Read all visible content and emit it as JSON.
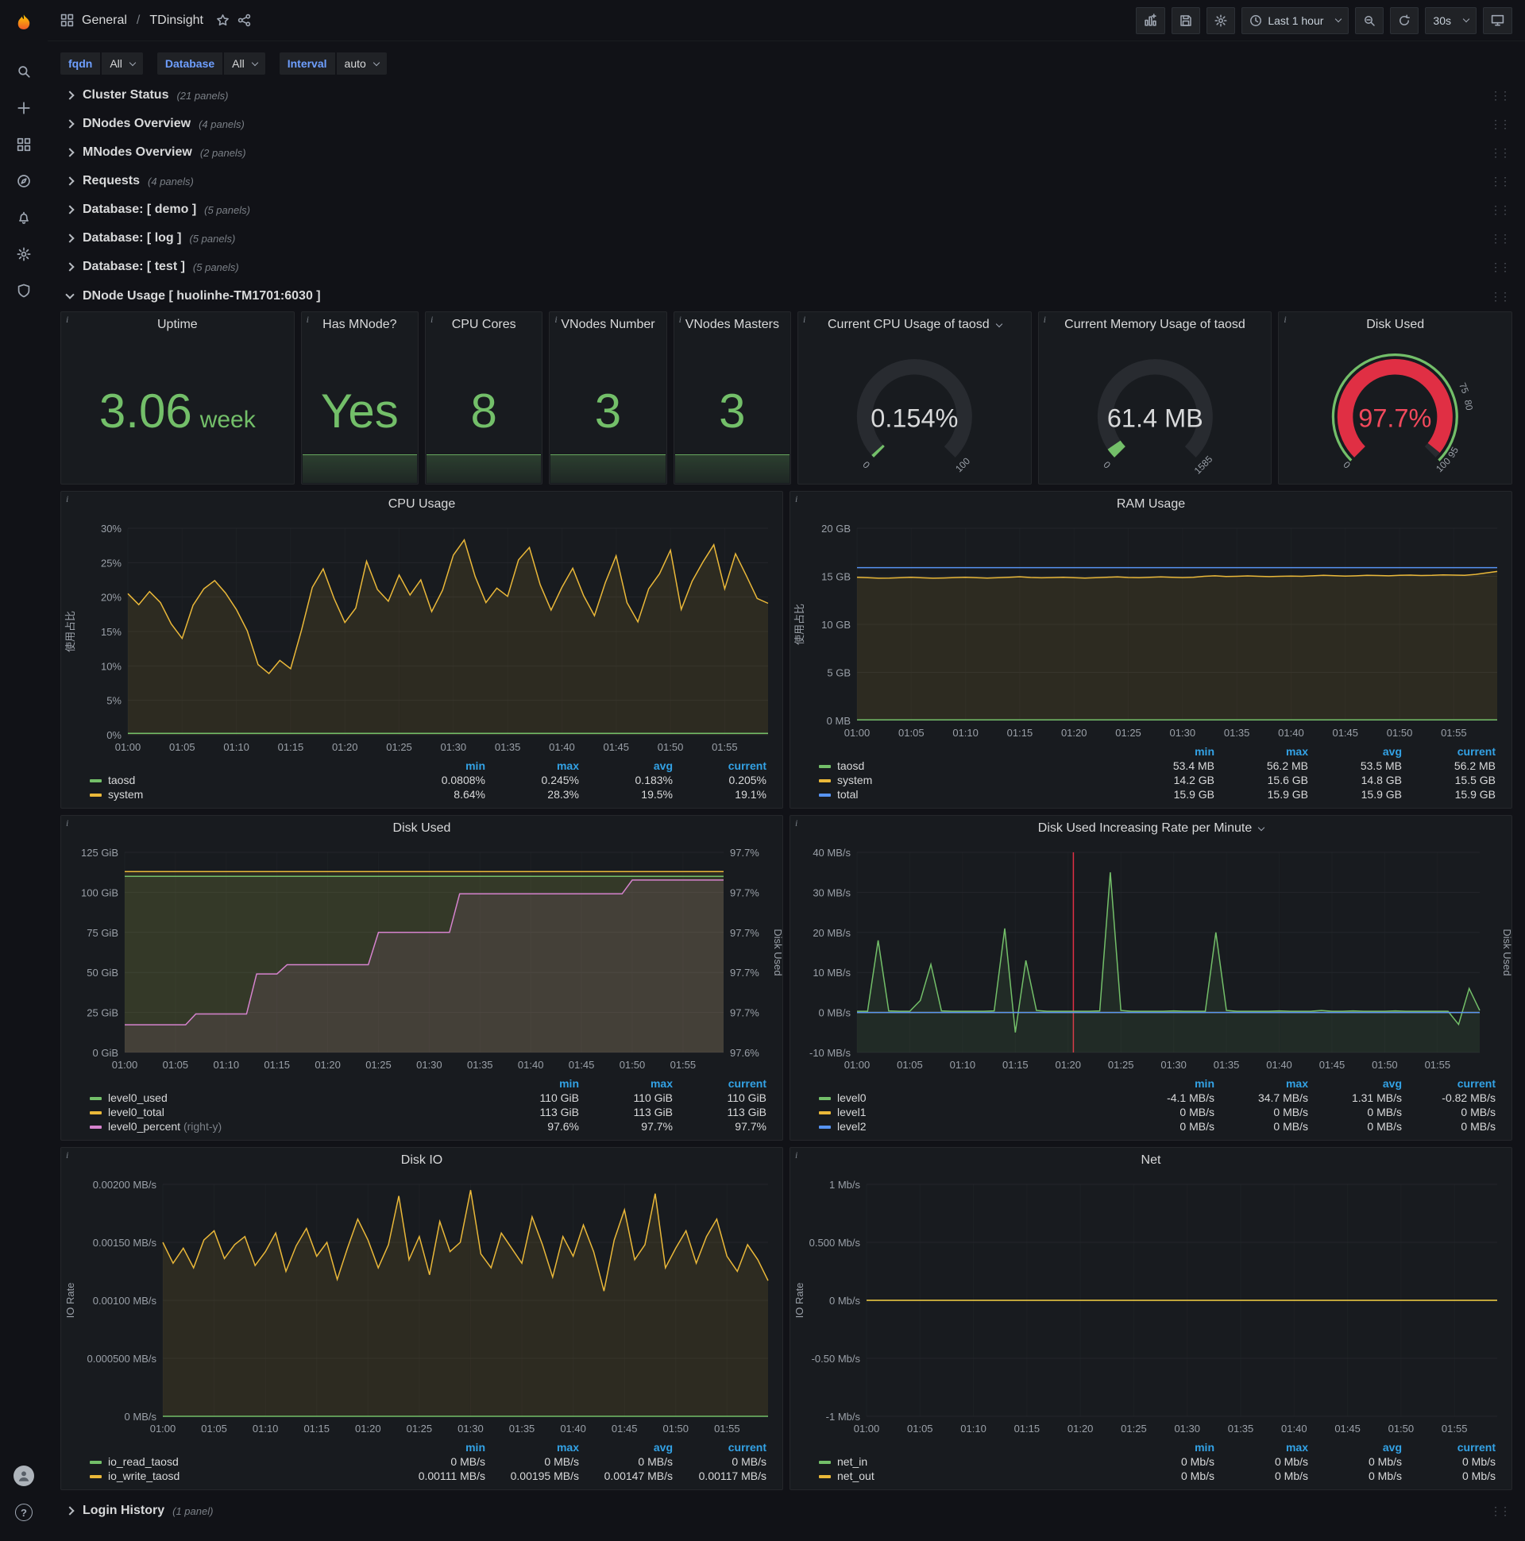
{
  "topbar": {
    "breadcrumb_folder": "General",
    "breadcrumb_separator": "/",
    "dashboard_title": "TDinsight",
    "time_range_label": "Last 1 hour",
    "refresh_label": "30s"
  },
  "variables": [
    {
      "label": "fqdn",
      "value": "All"
    },
    {
      "label": "Database",
      "value": "All"
    },
    {
      "label": "Interval",
      "value": "auto"
    }
  ],
  "collapsed_rows": [
    {
      "title": "Cluster Status",
      "count": "(21 panels)"
    },
    {
      "title": "DNodes Overview",
      "count": "(4 panels)"
    },
    {
      "title": "MNodes Overview",
      "count": "(2 panels)"
    },
    {
      "title": "Requests",
      "count": "(4 panels)"
    },
    {
      "title": "Database: [ demo ]",
      "count": "(5 panels)"
    },
    {
      "title": "Database: [ log ]",
      "count": "(5 panels)"
    },
    {
      "title": "Database: [ test ]",
      "count": "(5 panels)"
    }
  ],
  "dnode_row": {
    "title": "DNode Usage [ huolinhe-TM1701:6030 ]"
  },
  "login_row": {
    "title": "Login History",
    "count": "(1 panel)"
  },
  "stat_panels": [
    {
      "title": "Uptime",
      "value": "3.06",
      "unit": "week"
    },
    {
      "title": "Has MNode?",
      "value": "Yes"
    },
    {
      "title": "CPU Cores",
      "value": "8"
    },
    {
      "title": "VNodes Number",
      "value": "3"
    },
    {
      "title": "VNodes Masters",
      "value": "3"
    }
  ],
  "gauge_panels": [
    {
      "id": "cpu_gauge",
      "title": "Current CPU Usage of taosd",
      "value": "0.154%",
      "percent": 0.154,
      "arc_color": "#73bf69",
      "value_color": "#d8d9da",
      "min_label": "0",
      "max_label": "100",
      "dropdown": true
    },
    {
      "id": "mem_gauge",
      "title": "Current Memory Usage of taosd",
      "value": "61.4 MB",
      "percent": 3.9,
      "arc_color": "#73bf69",
      "value_color": "#d8d9da",
      "min_label": "0",
      "max_label": "1585"
    },
    {
      "id": "disk_gauge",
      "title": "Disk Used",
      "value": "97.7%",
      "percent": 97.7,
      "arc_color": "#e02f44",
      "value_color": "#f2495c",
      "min_label": "0",
      "outer_ring": true,
      "ticks": [
        {
          "f": 0.75,
          "l": "75"
        },
        {
          "f": 0.8,
          "l": "80"
        },
        {
          "f": 0.95,
          "l": "95"
        },
        {
          "f": 1,
          "l": "100"
        }
      ]
    }
  ],
  "chart_data": [
    {
      "id": "cpu_usage",
      "type": "line",
      "title": "CPU Usage",
      "ylabel": "使用占比",
      "ylim": [
        0,
        30
      ],
      "n": 60,
      "ml": 84,
      "mr": 18,
      "yticks": [
        {
          "v": 0,
          "l": "0%"
        },
        {
          "v": 5,
          "l": "5%"
        },
        {
          "v": 10,
          "l": "10%"
        },
        {
          "v": 15,
          "l": "15%"
        },
        {
          "v": 20,
          "l": "20%"
        },
        {
          "v": 25,
          "l": "25%"
        },
        {
          "v": 30,
          "l": "30%"
        }
      ],
      "xticks": [
        "01:00",
        "01:05",
        "01:10",
        "01:15",
        "01:20",
        "01:25",
        "01:30",
        "01:35",
        "01:40",
        "01:45",
        "01:50",
        "01:55"
      ],
      "series": [
        {
          "name": "system",
          "color": "#eab839",
          "fill": true,
          "values": [
            20.5,
            18.9,
            20.8,
            19.2,
            16.1,
            14.0,
            18.8,
            21.2,
            22.4,
            20.6,
            18.2,
            15.1,
            10.2,
            8.9,
            10.8,
            9.6,
            15.2,
            21.4,
            24.1,
            19.8,
            16.3,
            18.4,
            25.2,
            21.1,
            19.4,
            23.2,
            20.3,
            22.5,
            17.9,
            21.0,
            26.1,
            28.3,
            23.0,
            19.2,
            21.3,
            20.1,
            25.4,
            27.2,
            21.8,
            18.1,
            21.4,
            24.2,
            20.2,
            17.3,
            22.1,
            26.0,
            19.2,
            16.4,
            21.2,
            23.4,
            26.8,
            18.2,
            22.3,
            25.1,
            27.6,
            21.2,
            26.3,
            23.1,
            19.8,
            19.1
          ]
        },
        {
          "name": "taosd",
          "color": "#73bf69",
          "flat": 0.2
        }
      ],
      "legend": {
        "columns": [
          "min",
          "max",
          "avg",
          "current"
        ],
        "rows": [
          {
            "name": "taosd",
            "color": "#73bf69",
            "values": [
              "0.0808%",
              "0.245%",
              "0.183%",
              "0.205%"
            ]
          },
          {
            "name": "system",
            "color": "#eab839",
            "values": [
              "8.64%",
              "28.3%",
              "19.5%",
              "19.1%"
            ]
          }
        ]
      }
    },
    {
      "id": "ram_usage",
      "type": "line",
      "title": "RAM Usage",
      "ylabel": "使用占比",
      "ylim": [
        0,
        20
      ],
      "n": 60,
      "ml": 84,
      "mr": 18,
      "yticks": [
        {
          "v": 0,
          "l": "0 MB"
        },
        {
          "v": 5,
          "l": "5 GB"
        },
        {
          "v": 10,
          "l": "10 GB"
        },
        {
          "v": 15,
          "l": "15 GB"
        },
        {
          "v": 20,
          "l": "20 GB"
        }
      ],
      "xticks": [
        "01:00",
        "01:05",
        "01:10",
        "01:15",
        "01:20",
        "01:25",
        "01:30",
        "01:35",
        "01:40",
        "01:45",
        "01:50",
        "01:55"
      ],
      "series": [
        {
          "name": "system",
          "color": "#eab839",
          "fill": true,
          "values": [
            14.9,
            14.85,
            14.8,
            14.82,
            14.86,
            14.9,
            14.84,
            14.8,
            14.83,
            14.87,
            14.9,
            14.86,
            14.82,
            14.85,
            14.9,
            14.95,
            14.88,
            14.84,
            14.87,
            14.9,
            14.85,
            14.82,
            14.86,
            14.9,
            14.93,
            14.88,
            14.85,
            14.9,
            14.94,
            14.9,
            14.87,
            14.9,
            15.0,
            15.05,
            14.98,
            15.0,
            15.04,
            15.0,
            14.97,
            15.0,
            15.02,
            15.0,
            15.05,
            15.1,
            15.06,
            15.02,
            15.05,
            15.1,
            15.08,
            15.05,
            15.1,
            15.12,
            15.08,
            15.1,
            15.15,
            15.12,
            15.1,
            15.2,
            15.35,
            15.5
          ]
        },
        {
          "name": "total",
          "color": "#5794f2",
          "flat": 15.9
        },
        {
          "name": "taosd",
          "color": "#73bf69",
          "flat": 0.055
        }
      ],
      "legend": {
        "columns": [
          "min",
          "max",
          "avg",
          "current"
        ],
        "rows": [
          {
            "name": "taosd",
            "color": "#73bf69",
            "values": [
              "53.4 MB",
              "56.2 MB",
              "53.5 MB",
              "56.2 MB"
            ]
          },
          {
            "name": "system",
            "color": "#eab839",
            "values": [
              "14.2 GB",
              "15.6 GB",
              "14.8 GB",
              "15.5 GB"
            ]
          },
          {
            "name": "total",
            "color": "#5794f2",
            "values": [
              "15.9 GB",
              "15.9 GB",
              "15.9 GB",
              "15.9 GB"
            ]
          }
        ]
      }
    },
    {
      "id": "disk_used",
      "type": "line",
      "title": "Disk Used",
      "ylim": [
        0,
        125
      ],
      "n": 60,
      "ml": 80,
      "mr": 74,
      "y2lim": [
        97.585,
        97.715
      ],
      "y2label": "Disk Used",
      "y2ticks": [
        "97.6%",
        "97.7%",
        "97.7%",
        "97.7%",
        "97.7%",
        "97.7%"
      ],
      "yticks": [
        {
          "v": 0,
          "l": "0 GiB"
        },
        {
          "v": 25,
          "l": "25 GiB"
        },
        {
          "v": 50,
          "l": "50 GiB"
        },
        {
          "v": 75,
          "l": "75 GiB"
        },
        {
          "v": 100,
          "l": "100 GiB"
        },
        {
          "v": 125,
          "l": "125 GiB"
        }
      ],
      "xticks": [
        "01:00",
        "01:05",
        "01:10",
        "01:15",
        "01:20",
        "01:25",
        "01:30",
        "01:35",
        "01:40",
        "01:45",
        "01:50",
        "01:55"
      ],
      "series": [
        {
          "name": "level0_total",
          "color": "#eab839",
          "fill": true,
          "flat": 113
        },
        {
          "name": "level0_used",
          "color": "#73bf69",
          "fill": true,
          "flat": 110
        },
        {
          "name": "level0_percent",
          "color": "#d683ce",
          "fill": true,
          "axis": "y2",
          "values": [
            97.603,
            97.603,
            97.603,
            97.603,
            97.603,
            97.603,
            97.603,
            97.61,
            97.61,
            97.61,
            97.61,
            97.61,
            97.61,
            97.636,
            97.636,
            97.636,
            97.642,
            97.642,
            97.642,
            97.642,
            97.642,
            97.642,
            97.642,
            97.642,
            97.642,
            97.663,
            97.663,
            97.663,
            97.663,
            97.663,
            97.663,
            97.663,
            97.663,
            97.688,
            97.688,
            97.688,
            97.688,
            97.688,
            97.688,
            97.688,
            97.688,
            97.688,
            97.688,
            97.688,
            97.688,
            97.688,
            97.688,
            97.688,
            97.688,
            97.688,
            97.697,
            97.697,
            97.697,
            97.697,
            97.697,
            97.697,
            97.697,
            97.697,
            97.697,
            97.697
          ]
        }
      ],
      "legend": {
        "columns": [
          "min",
          "max",
          "current"
        ],
        "rows": [
          {
            "name": "level0_used",
            "color": "#73bf69",
            "values": [
              "110 GiB",
              "110 GiB",
              "110 GiB"
            ]
          },
          {
            "name": "level0_total",
            "color": "#eab839",
            "values": [
              "113 GiB",
              "113 GiB",
              "113 GiB"
            ]
          },
          {
            "name": "level0_percent",
            "suffix": "(right-y)",
            "color": "#d683ce",
            "values": [
              "97.6%",
              "97.7%",
              "97.7%"
            ]
          }
        ]
      }
    },
    {
      "id": "disk_rate",
      "type": "line",
      "title": "Disk Used Increasing Rate per Minute",
      "dropdown": true,
      "ylim": [
        -10,
        40
      ],
      "n": 60,
      "ml": 84,
      "mr": 40,
      "y2label": "Disk Used",
      "annotation_x": 20.5,
      "yticks": [
        {
          "v": -10,
          "l": "-10 MB/s"
        },
        {
          "v": 0,
          "l": "0 MB/s"
        },
        {
          "v": 10,
          "l": "10 MB/s"
        },
        {
          "v": 20,
          "l": "20 MB/s"
        },
        {
          "v": 30,
          "l": "30 MB/s"
        },
        {
          "v": 40,
          "l": "40 MB/s"
        }
      ],
      "xticks": [
        "01:00",
        "01:05",
        "01:10",
        "01:15",
        "01:20",
        "01:25",
        "01:30",
        "01:35",
        "01:40",
        "01:45",
        "01:50",
        "01:55"
      ],
      "series": [
        {
          "name": "level0",
          "color": "#73bf69",
          "fill": true,
          "values": [
            0.3,
            0.3,
            18,
            0.4,
            0.3,
            0.3,
            3,
            12,
            0.4,
            0.3,
            0.3,
            0.3,
            0.3,
            0.4,
            21,
            -5,
            13,
            0.5,
            0.3,
            0.3,
            0.3,
            0.3,
            0.3,
            0.4,
            35,
            0.5,
            0.3,
            0.3,
            0.3,
            0.3,
            0.4,
            0.3,
            0.3,
            0.3,
            20,
            0.5,
            0.3,
            0.3,
            0.3,
            0.3,
            0.4,
            0.3,
            0.3,
            0.3,
            0.5,
            0.3,
            0.3,
            0.4,
            0.3,
            0.3,
            0.3,
            0.4,
            0.3,
            0.3,
            0.3,
            0.3,
            0.3,
            -3,
            6,
            0.5
          ]
        },
        {
          "name": "level1",
          "color": "#eab839",
          "flat": 0
        },
        {
          "name": "level2",
          "color": "#5794f2",
          "flat": 0
        }
      ],
      "legend": {
        "columns": [
          "min",
          "max",
          "avg",
          "current"
        ],
        "rows": [
          {
            "name": "level0",
            "color": "#73bf69",
            "values": [
              "-4.1 MB/s",
              "34.7 MB/s",
              "1.31 MB/s",
              "-0.82 MB/s"
            ]
          },
          {
            "name": "level1",
            "color": "#eab839",
            "values": [
              "0 MB/s",
              "0 MB/s",
              "0 MB/s",
              "0 MB/s"
            ]
          },
          {
            "name": "level2",
            "color": "#5794f2",
            "values": [
              "0 MB/s",
              "0 MB/s",
              "0 MB/s",
              "0 MB/s"
            ]
          }
        ]
      }
    },
    {
      "id": "disk_io",
      "type": "line",
      "title": "Disk IO",
      "ylabel": "IO Rate",
      "ylim": [
        0,
        0.002
      ],
      "n": 60,
      "ml": 128,
      "mr": 18,
      "yticks": [
        {
          "v": 0,
          "l": "0 MB/s"
        },
        {
          "v": 0.0005,
          "l": "0.000500 MB/s"
        },
        {
          "v": 0.001,
          "l": "0.00100 MB/s"
        },
        {
          "v": 0.0015,
          "l": "0.00150 MB/s"
        },
        {
          "v": 0.002,
          "l": "0.00200 MB/s"
        }
      ],
      "xticks": [
        "01:00",
        "01:05",
        "01:10",
        "01:15",
        "01:20",
        "01:25",
        "01:30",
        "01:35",
        "01:40",
        "01:45",
        "01:50",
        "01:55"
      ],
      "series": [
        {
          "name": "io_write_taosd",
          "color": "#eab839",
          "fill": true,
          "values": [
            0.0015,
            0.00132,
            0.00145,
            0.00128,
            0.00152,
            0.0016,
            0.00136,
            0.00148,
            0.00155,
            0.0013,
            0.00142,
            0.00158,
            0.00125,
            0.00147,
            0.00162,
            0.00138,
            0.0015,
            0.00118,
            0.00145,
            0.0017,
            0.00152,
            0.00128,
            0.00148,
            0.0019,
            0.00135,
            0.00155,
            0.00122,
            0.00168,
            0.00142,
            0.0015,
            0.00195,
            0.0014,
            0.00128,
            0.00158,
            0.00145,
            0.00132,
            0.00172,
            0.00148,
            0.0012,
            0.00155,
            0.00138,
            0.00165,
            0.00142,
            0.00108,
            0.00152,
            0.00178,
            0.00135,
            0.00148,
            0.00192,
            0.00128,
            0.00145,
            0.0016,
            0.00132,
            0.00155,
            0.0017,
            0.00138,
            0.00125,
            0.00148,
            0.00135,
            0.00117
          ]
        },
        {
          "name": "io_read_taosd",
          "color": "#73bf69",
          "flat": 0
        }
      ],
      "legend": {
        "columns": [
          "min",
          "max",
          "avg",
          "current"
        ],
        "rows": [
          {
            "name": "io_read_taosd",
            "color": "#73bf69",
            "values": [
              "0 MB/s",
              "0 MB/s",
              "0 MB/s",
              "0 MB/s"
            ]
          },
          {
            "name": "io_write_taosd",
            "color": "#eab839",
            "values": [
              "0.00111 MB/s",
              "0.00195 MB/s",
              "0.00147 MB/s",
              "0.00117 MB/s"
            ]
          }
        ]
      }
    },
    {
      "id": "net",
      "type": "line",
      "title": "Net",
      "ylabel": "IO Rate",
      "ylim": [
        -1,
        1
      ],
      "n": 60,
      "ml": 96,
      "mr": 18,
      "yticks": [
        {
          "v": -1,
          "l": "-1 Mb/s"
        },
        {
          "v": -0.5,
          "l": "-0.50 Mb/s"
        },
        {
          "v": 0,
          "l": "0 Mb/s"
        },
        {
          "v": 0.5,
          "l": "0.500 Mb/s"
        },
        {
          "v": 1,
          "l": "1 Mb/s"
        }
      ],
      "xticks": [
        "01:00",
        "01:05",
        "01:10",
        "01:15",
        "01:20",
        "01:25",
        "01:30",
        "01:35",
        "01:40",
        "01:45",
        "01:50",
        "01:55"
      ],
      "series": [
        {
          "name": "net_in",
          "color": "#73bf69",
          "flat": 0
        },
        {
          "name": "net_out",
          "color": "#eab839",
          "flat": 0
        }
      ],
      "legend": {
        "columns": [
          "min",
          "max",
          "avg",
          "current"
        ],
        "rows": [
          {
            "name": "net_in",
            "color": "#73bf69",
            "values": [
              "0 Mb/s",
              "0 Mb/s",
              "0 Mb/s",
              "0 Mb/s"
            ]
          },
          {
            "name": "net_out",
            "color": "#eab839",
            "values": [
              "0 Mb/s",
              "0 Mb/s",
              "0 Mb/s",
              "0 Mb/s"
            ]
          }
        ]
      }
    }
  ]
}
